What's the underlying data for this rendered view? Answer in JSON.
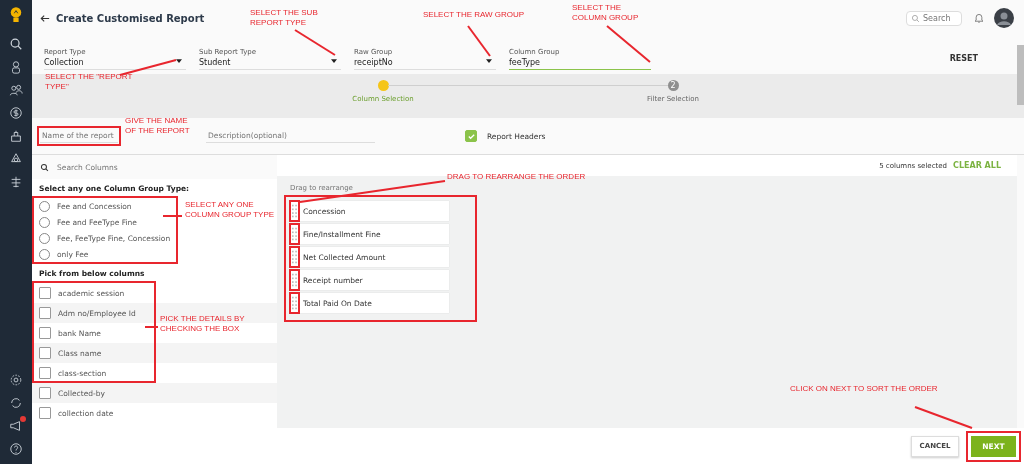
{
  "header": {
    "title": "Create Customised Report",
    "search_placeholder": "Search"
  },
  "filters": [
    {
      "label": "Report Type",
      "value": "Collection",
      "kind": "select"
    },
    {
      "label": "Sub Report Type",
      "value": "Student",
      "kind": "select"
    },
    {
      "label": "Raw Group",
      "value": "receiptNo",
      "kind": "select"
    },
    {
      "label": "Column Group",
      "value": "feeType",
      "kind": "text"
    }
  ],
  "reset": "RESET",
  "steps": [
    {
      "label": "Column Selection",
      "active": true
    },
    {
      "label": "Filter Selection",
      "number": "2",
      "active": false
    }
  ],
  "report_name": {
    "placeholder": "Name of the report"
  },
  "description": {
    "placeholder": "Description(optional)"
  },
  "report_headers": {
    "label": "Report Headers",
    "checked": true
  },
  "columns_panel": {
    "search_placeholder": "Search Columns",
    "group_type_heading": "Select any one Column Group Type:",
    "group_types": [
      {
        "label": "Fee and Concession",
        "selected": false
      },
      {
        "label": "Fee and FeeType Fine",
        "selected": false
      },
      {
        "label": "Fee, FeeType Fine, Concession",
        "selected": false
      },
      {
        "label": "only Fee",
        "selected": false
      }
    ],
    "pick_heading": "Pick from below columns",
    "columns": [
      {
        "label": "academic session",
        "checked": false
      },
      {
        "label": "Adm no/Employee Id",
        "checked": false
      },
      {
        "label": "bank Name",
        "checked": false
      },
      {
        "label": "Class name",
        "checked": false
      },
      {
        "label": "class-section",
        "checked": false
      },
      {
        "label": "Collected-by",
        "checked": false
      },
      {
        "label": "collection date",
        "checked": false
      }
    ]
  },
  "selection": {
    "count_text": "5 columns selected",
    "clear_all": "CLEAR ALL",
    "hint": "Drag to rearrange",
    "items": [
      "Concession",
      "Fine/Installment Fine",
      "Net Collected Amount",
      "Receipt number",
      "Total Paid On Date"
    ]
  },
  "buttons": {
    "cancel": "CANCEL",
    "next": "NEXT"
  },
  "annotations": [
    {
      "text": "SELECT THE SUB REPORT TYPE"
    },
    {
      "text": "SELECT THE RAW GROUP"
    },
    {
      "text": "SELECT THE COLUMN GROUP"
    },
    {
      "text": "SELECT THE \"REPORT TYPE\""
    },
    {
      "text": "GIVE THE NAME OF THE REPORT"
    },
    {
      "text": "SELECT ANY ONE COLUMN GROUP TYPE"
    },
    {
      "text": "PICK THE DETAILS BY CHECKING THE BOX"
    },
    {
      "text": "DRAG TO REARRANGE THE ORDER"
    },
    {
      "text": "CLICK ON NEXT TO SORT THE ORDER"
    }
  ]
}
